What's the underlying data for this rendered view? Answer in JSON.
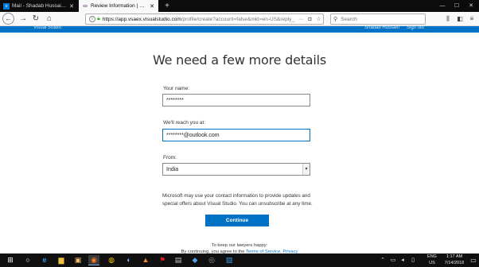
{
  "browser": {
    "tabs": [
      {
        "title": "Mail - Shadab Hussain - Outlo",
        "active": false
      },
      {
        "title": "Review Information | Microsoft",
        "active": true
      }
    ],
    "new_tab": "+",
    "url_host": "https://app.vsaex.visualstudio.com",
    "url_rest": "/profile/create?account=false&mkt=en-US&reply_",
    "url_more": "···",
    "search_placeholder": "Search"
  },
  "site_header": {
    "brand": "Visual Studio",
    "user": "Shadab Hussain",
    "signout": "Sign out"
  },
  "form": {
    "heading": "We need a few more details",
    "name_label": "Your name:",
    "name_value": "********",
    "email_label": "We'll reach you at:",
    "email_value": "********@outlook.com",
    "country_label": "From:",
    "country_value": "India",
    "disclaimer": "Microsoft may use your contact information to provide updates and special offers about Visual Studio. You can unsubscribe at any time.",
    "continue_label": "Continue",
    "lawyers_line1": "To keep our lawyers happy:",
    "lawyers_prefix": "By continuing, you agree to the",
    "terms_link": "Terms of Service",
    "separator": ",",
    "privacy_link": "Privacy"
  },
  "taskbar": {
    "language": "ENG",
    "region": "US",
    "time": "1:17 AM",
    "date": "7/14/2018"
  },
  "colors": {
    "accent": "#0072c6",
    "tabstrip": "#0c0c0d",
    "taskbar": "#101010"
  }
}
